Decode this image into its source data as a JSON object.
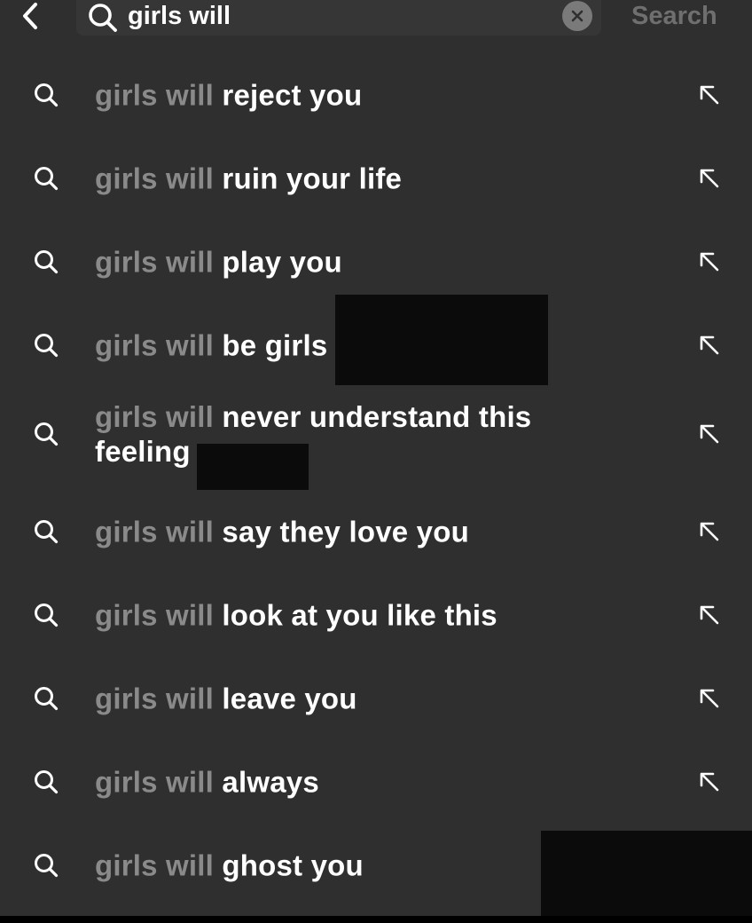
{
  "search": {
    "query": "girls will",
    "search_label": "Search"
  },
  "suggestions": [
    {
      "prefix": "girls will",
      "rest": "reject you"
    },
    {
      "prefix": "girls will",
      "rest": "ruin your life"
    },
    {
      "prefix": "girls will",
      "rest": "play you"
    },
    {
      "prefix": "girls will",
      "rest": "be girls"
    },
    {
      "prefix": "girls will",
      "rest": "never understand this feeling"
    },
    {
      "prefix": "girls will",
      "rest": "say they love you"
    },
    {
      "prefix": "girls will",
      "rest": "look at you like this"
    },
    {
      "prefix": "girls will",
      "rest": "leave you"
    },
    {
      "prefix": "girls will",
      "rest": "always"
    },
    {
      "prefix": "girls will",
      "rest": "ghost you"
    }
  ],
  "icons": {
    "back": "chevron-left-icon",
    "search": "search-icon",
    "clear": "clear-icon",
    "fill_query": "arrow-up-left-icon"
  },
  "colors": {
    "background": "#2f2f2f",
    "prefix_text": "#8a8a8a",
    "suggestion_text": "#ffffff",
    "search_label": "#6f6f6f",
    "clear_button": "#7a7a7a"
  }
}
